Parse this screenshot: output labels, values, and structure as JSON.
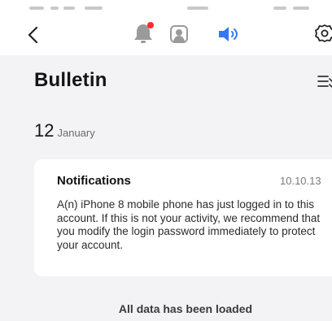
{
  "header": {
    "title": "Bulletin"
  },
  "date_group": {
    "day": "12",
    "month": "January"
  },
  "notification": {
    "title": "Notifications",
    "time": "10.10.13",
    "body": "A(n) iPhone 8 mobile phone has just logged in to this account. If this is not your activity, we recommend that you modify the login password immediately to protect your account."
  },
  "footer": {
    "status": "All data has been loaded"
  },
  "colors": {
    "accent_blue": "#3478f6",
    "badge_red": "#ff2b2b",
    "icon_gray": "#9a9a9a",
    "background": "#f3f3f5"
  },
  "icons": {
    "back": "chevron-left-icon",
    "bell": "bell-icon",
    "user": "user-icon",
    "speaker": "speaker-icon",
    "settings": "gear-icon",
    "filter": "filter-list-icon"
  }
}
